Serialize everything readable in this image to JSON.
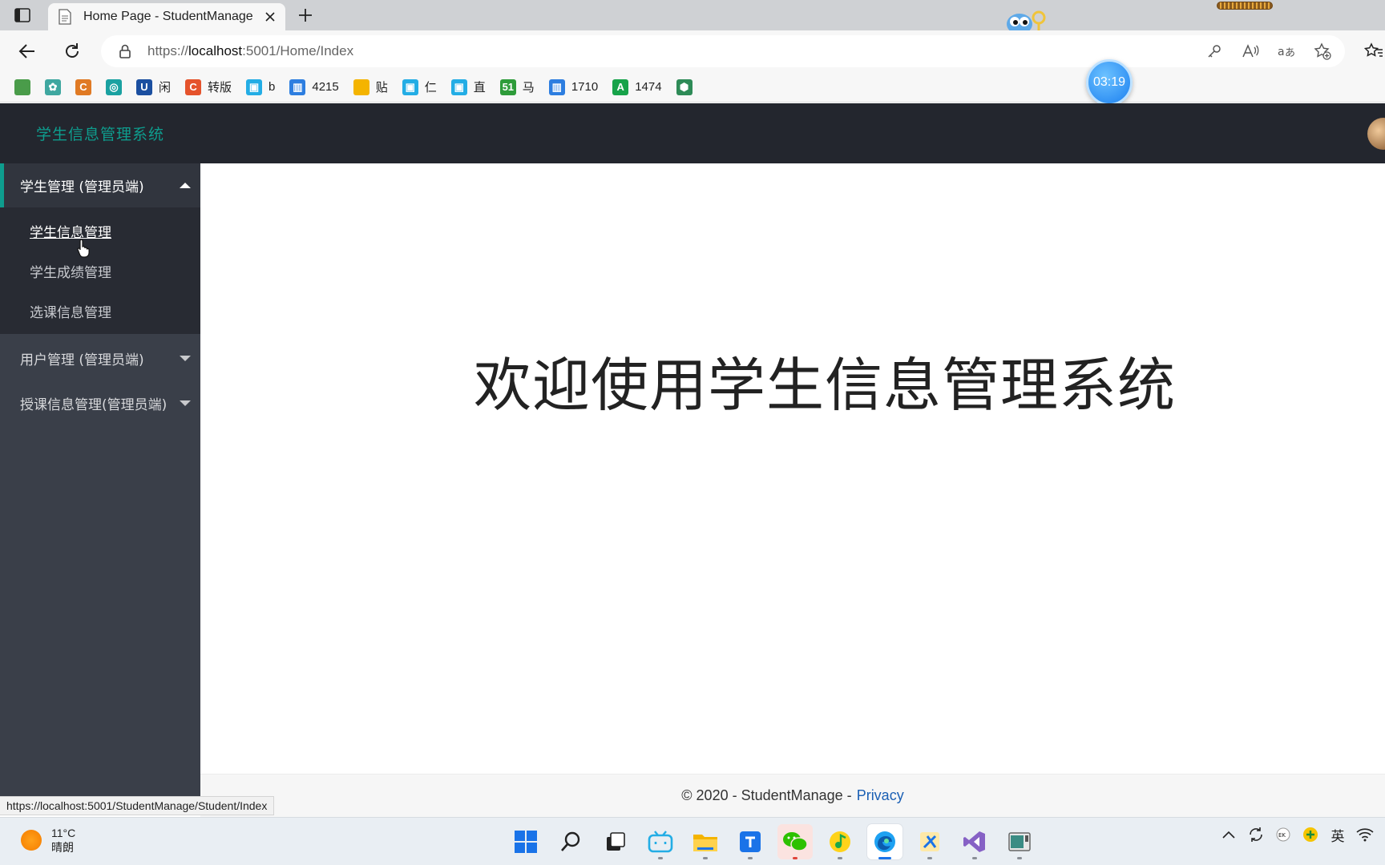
{
  "browser": {
    "tab": {
      "title": "Home Page - StudentManage"
    },
    "address": {
      "prefix": "https://",
      "host": "localhost",
      "rest": ":5001/Home/Index"
    },
    "bookmarks": [
      {
        "label": "",
        "icon": "colored-square-icon",
        "color": "#4a9c4a"
      },
      {
        "label": "",
        "icon": "gear-flower-icon",
        "color": "#3fa7a0"
      },
      {
        "label": "",
        "icon": "c-orange-icon",
        "color": "#e07a24"
      },
      {
        "label": "",
        "icon": "swirl-icon",
        "color": "#1aa1a1"
      },
      {
        "label": "闲",
        "icon": "u-icon",
        "color": "#1b4fa0"
      },
      {
        "label": "转版",
        "icon": "c-red-icon",
        "color": "#e5532c"
      },
      {
        "label": "b",
        "icon": "bilibili-icon",
        "color": "#23ade5"
      },
      {
        "label": "4215",
        "icon": "book-icon",
        "color": "#2d7ee0"
      },
      {
        "label": "贴",
        "icon": "note-icon",
        "color": "#f4b400"
      },
      {
        "label": "仁",
        "icon": "bilibili-icon",
        "color": "#23ade5"
      },
      {
        "label": "直",
        "icon": "bilibili-icon",
        "color": "#23ade5"
      },
      {
        "label": "马",
        "icon": "51-icon",
        "color": "#2e9c3a"
      },
      {
        "label": "1710",
        "icon": "book-icon",
        "color": "#2d7ee0"
      },
      {
        "label": "1474",
        "icon": "a-green-icon",
        "color": "#17a34a"
      },
      {
        "label": "",
        "icon": "shield-icon",
        "color": "#2e8b57"
      }
    ],
    "timer": "03:19",
    "status_url": "https://localhost:5001/StudentManage/Student/Index"
  },
  "app": {
    "logo": "学生信息管理系统",
    "sidebar": [
      {
        "label": "学生管理 (管理员端)",
        "open": true,
        "children": [
          {
            "label": "学生信息管理",
            "active": true
          },
          {
            "label": "学生成绩管理",
            "active": false
          },
          {
            "label": "选课信息管理",
            "active": false
          }
        ]
      },
      {
        "label": "用户管理 (管理员端)",
        "open": false
      },
      {
        "label": "授课信息管理(管理员端)",
        "open": false
      }
    ],
    "welcome": "欢迎使用学生信息管理系统",
    "footer": {
      "text": "© 2020 - StudentManage -",
      "link": "Privacy"
    }
  },
  "taskbar": {
    "weather": {
      "temp": "11°C",
      "desc": "晴朗"
    },
    "apps": [
      "windows-start-icon",
      "search-icon",
      "task-view-icon",
      "bilibili-icon",
      "file-explorer-icon",
      "translator-icon",
      "wechat-icon",
      "music-icon",
      "edge-icon",
      "tools-icon",
      "visual-studio-icon",
      "terminal-icon"
    ],
    "ime": "英"
  },
  "colors": {
    "accent": "#0e9d8e",
    "header": "#23262e",
    "sidebar": "#3a3f49"
  }
}
